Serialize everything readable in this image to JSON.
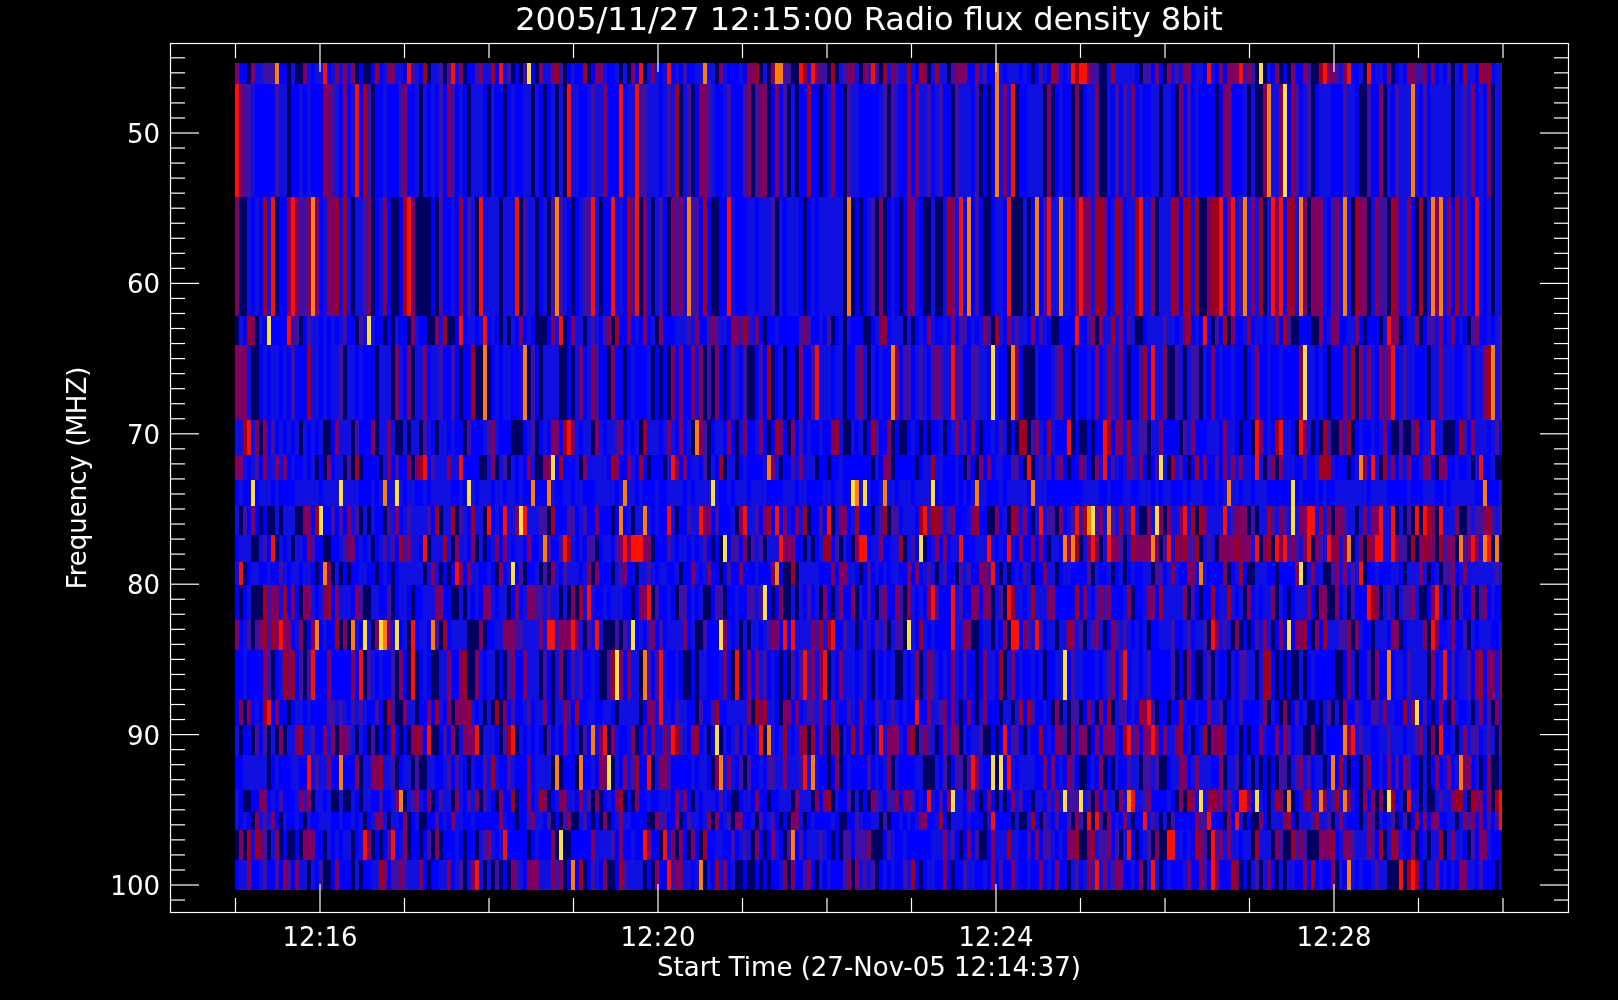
{
  "plot": {
    "title": "2005/11/27 12:15:00 Radio flux density 8bit",
    "ylabel": "Frequency (MHZ)",
    "xlabel": "Start Time (27-Nov-05 12:14:37)",
    "y_tick_labels": [
      "50",
      "60",
      "70",
      "80",
      "90",
      "100"
    ],
    "x_tick_labels": [
      "12:16",
      "12:20",
      "12:24",
      "12:28"
    ]
  }
}
